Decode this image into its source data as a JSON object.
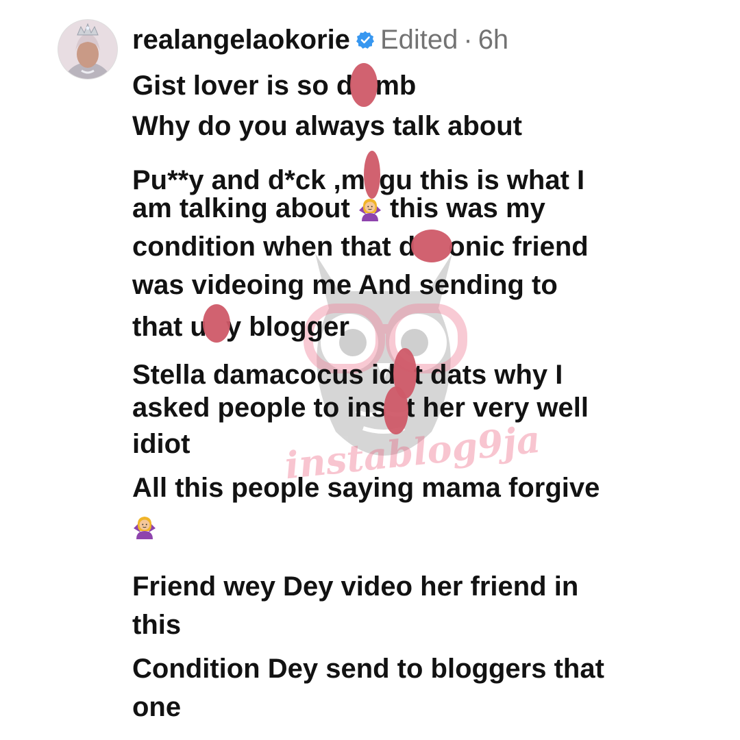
{
  "comment": {
    "author": {
      "username": "realangelaokorie",
      "verified_icon": "verified-badge-icon",
      "avatar_icon": "avatar"
    },
    "status": "Edited",
    "separator": "·",
    "timestamp": "6h",
    "lines": {
      "l1_a": "Gist lover is so d",
      "l1_b": "mb",
      "l2": "Why do you always talk about",
      "l3_a": "Pu**y and d*ck ,m",
      "l3_b": "gu this is what I",
      "l4_a": "am talking about ",
      "l4_b": " this was my",
      "l5_a": "condition when that d",
      "l5_b": "onic friend",
      "l6": "was videoing me And sending to",
      "l7_a": "that u",
      "l7_b": "y blogger",
      "l8_a": "Stella damacocus id",
      "l8_b": "t dats why I",
      "l9_a": "asked people to ins",
      "l9_b": "t her very well",
      "l10": "idiot",
      "l11": "All this people saying mama forgive",
      "l12": "Friend wey Dey video her friend in",
      "l13": "this",
      "l14": "Condition Dey send to bloggers that",
      "l15": "one"
    },
    "emoji_icon": "person-shrugging-emoji-icon"
  },
  "watermark": {
    "text": "instablog9ja",
    "icon": "owl-logo-watermark"
  },
  "colors": {
    "text": "#121212",
    "meta": "#737373",
    "verified": "#3797f0",
    "redaction": "#cf5a68"
  }
}
